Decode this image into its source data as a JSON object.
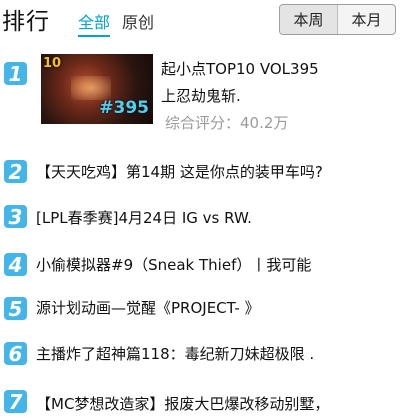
{
  "header": {
    "title": "排行",
    "tabs": {
      "all": "全部",
      "original": "原创"
    },
    "period": {
      "week": "本周",
      "month": "本月"
    }
  },
  "featured": {
    "rank": "1",
    "thumb_badge": "10",
    "thumb_episode": "#395",
    "title_line1": "起小点TOP10 VOL395",
    "title_line2": "上忍劫鬼斩.",
    "score_label": "综合评分：",
    "score_value": "40.2万"
  },
  "items": [
    {
      "rank": "2",
      "title": "【天天吃鸡】第14期 这是你点的装甲车吗?"
    },
    {
      "rank": "3",
      "title": "[LPL春季赛]4月24日 IG vs RW."
    },
    {
      "rank": "4",
      "title": "小偷模拟器#9（Sneak Thief）丨我可能"
    },
    {
      "rank": "5",
      "title": "源计划动画—觉醒《PROJECT- 》"
    },
    {
      "rank": "6",
      "title": "主播炸了超神篇118：毒纪新刀妹超极限 ."
    },
    {
      "rank": "7",
      "title": "【MC梦想改造家】报废大巴爆改移动别墅，"
    }
  ]
}
